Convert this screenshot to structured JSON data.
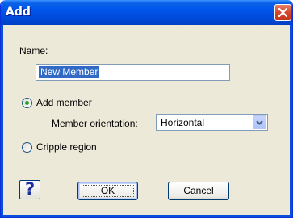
{
  "window": {
    "title": "Add"
  },
  "form": {
    "name_label": "Name:",
    "name_value": "New Member",
    "add_member_label": "Add member",
    "add_member_selected": true,
    "orientation_label": "Member orientation:",
    "orientation_value": "Horizontal",
    "cripple_region_label": "Cripple region",
    "cripple_region_selected": false
  },
  "buttons": {
    "help_label": "?",
    "ok_label": "OK",
    "cancel_label": "Cancel"
  },
  "icons": {
    "close": "close-icon",
    "dropdown": "chevron-down-icon",
    "help": "help-icon"
  },
  "colors": {
    "titlebar": "#0055ea",
    "dialog_bg": "#ece9d8",
    "selection": "#316ac5",
    "radio_dot": "#21a121",
    "close_button": "#d4472e"
  }
}
